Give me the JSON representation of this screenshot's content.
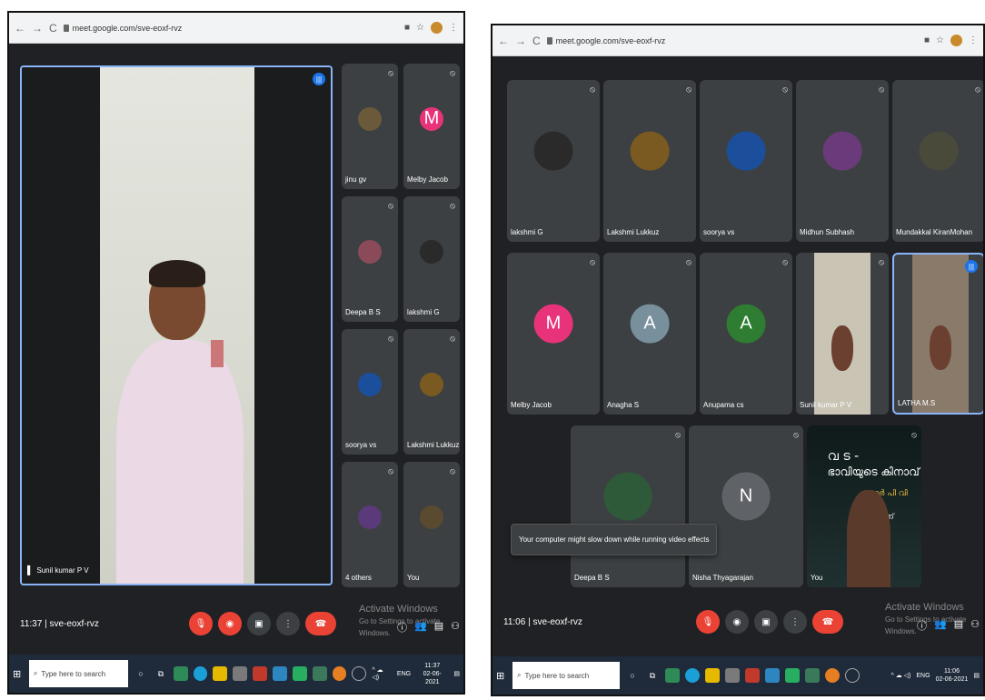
{
  "left": {
    "url": "meet.google.com/sve-eoxf-rvz",
    "main_speaker": "Sunil kumar P V",
    "tiles": [
      {
        "name": "jinu gv",
        "kind": "photo",
        "color": "#6b5a3a"
      },
      {
        "name": "Melby Jacob",
        "kind": "letter",
        "letter": "M",
        "color": "#e8337a"
      },
      {
        "name": "Deepa B S",
        "kind": "photo",
        "color": "#8a4a5a"
      },
      {
        "name": "lakshmi G",
        "kind": "photo",
        "color": "#2a2a2a"
      },
      {
        "name": "soorya vs",
        "kind": "photo",
        "color": "#1b4f9c"
      },
      {
        "name": "Lakshmi Lukkuz",
        "kind": "photo",
        "color": "#7a5a20"
      },
      {
        "name": "4 others",
        "kind": "others",
        "color": "#5a3a7a"
      },
      {
        "name": "You",
        "kind": "photo",
        "color": "#5a4a30"
      }
    ],
    "time": "11:37",
    "meeting_code": "sve-eoxf-rvz",
    "watermark_title": "Activate Windows",
    "watermark_sub": "Go to Settings to activate Windows.",
    "search_placeholder": "Type here to search",
    "tray_lang": "ENG",
    "clock_time": "11:37",
    "clock_date": "02-06-2021"
  },
  "right": {
    "url": "meet.google.com/sve-eoxf-rvz",
    "tiles_row1": [
      {
        "name": "lakshmi G",
        "kind": "photo",
        "color": "#2a2a2a"
      },
      {
        "name": "Lakshmi Lukkuz",
        "kind": "photo",
        "color": "#7a5a20"
      },
      {
        "name": "soorya vs",
        "kind": "photo",
        "color": "#1b4f9c"
      },
      {
        "name": "Midhun Subhash",
        "kind": "photo",
        "color": "#6a3a7a"
      },
      {
        "name": "Mundakkal KiranMohan",
        "kind": "photo",
        "color": "#4a4a3a"
      }
    ],
    "tiles_row2": [
      {
        "name": "Melby Jacob",
        "kind": "letter",
        "letter": "M",
        "color": "#e8337a"
      },
      {
        "name": "Anagha S",
        "kind": "letter",
        "letter": "A",
        "color": "#78909c"
      },
      {
        "name": "Anupama cs",
        "kind": "letter",
        "letter": "A",
        "color": "#2e7d32"
      },
      {
        "name": "Sunil kumar P V",
        "kind": "video",
        "color": "#c9c4b4"
      },
      {
        "name": "LATHA M.S",
        "kind": "video",
        "color": "#8a7a6a"
      }
    ],
    "tiles_row3": [
      {
        "name": "Deepa B S",
        "kind": "photo",
        "color": "#2e5a3a"
      },
      {
        "name": "Nisha Thyagarajan",
        "kind": "letter",
        "letter": "N",
        "color": "#5f6368"
      },
      {
        "name": "You",
        "kind": "poster",
        "color": "#1a2a2a"
      }
    ],
    "toast": "Your computer might slow down while running video effects",
    "poster_line1": "വ ട -",
    "poster_line2": "ഭാവിയുടെ കിനാവ്",
    "poster_line3": "കുമാർ പി വി",
    "poster_line4": "ഇ 11 ന്",
    "time": "11:06",
    "meeting_code": "sve-eoxf-rvz",
    "watermark_title": "Activate Windows",
    "watermark_sub": "Go to Settings to activate Windows.",
    "search_placeholder": "Type here to search",
    "tray_lang": "ENG",
    "clock_time": "11:06",
    "clock_date": "02-06-2021"
  }
}
